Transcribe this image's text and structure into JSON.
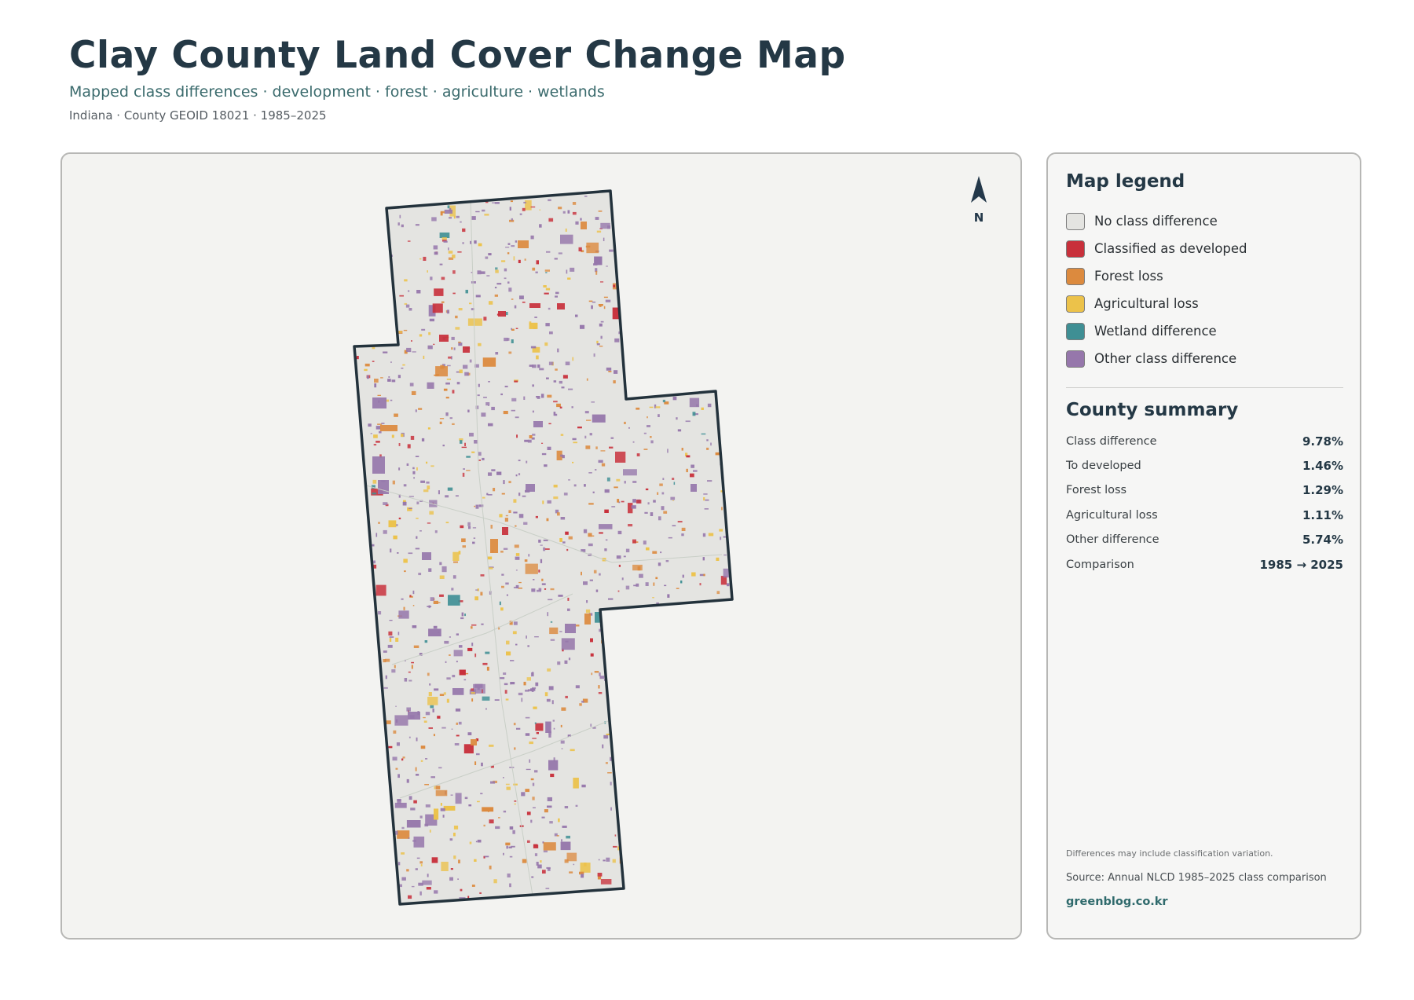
{
  "header": {
    "title": "Clay County Land Cover Change Map",
    "subtitle": "Mapped class differences · development · forest · agriculture · wetlands",
    "meta": "Indiana · County GEOID 18021 · 1985–2025"
  },
  "map": {
    "north_label": "N",
    "north_icon": "north-arrow-icon",
    "colors": {
      "background": "#f3f3f1",
      "county_fill": "#e4e4e1",
      "county_outline": "#23323c",
      "developed": "#c8303b",
      "forest_loss": "#dc8a3e",
      "agricultural_loss": "#ecc24a",
      "wetland": "#3f8f94",
      "other": "#9677ab"
    }
  },
  "legend": {
    "title": "Map legend",
    "items": [
      {
        "label": "No class difference",
        "color": "#e4e4e1"
      },
      {
        "label": "Classified as developed",
        "color": "#c8303b"
      },
      {
        "label": "Forest loss",
        "color": "#dc8a3e"
      },
      {
        "label": "Agricultural loss",
        "color": "#ecc24a"
      },
      {
        "label": "Wetland difference",
        "color": "#3f8f94"
      },
      {
        "label": "Other class difference",
        "color": "#9677ab"
      }
    ]
  },
  "summary": {
    "title": "County summary",
    "rows": [
      {
        "label": "Class difference",
        "value": "9.78%"
      },
      {
        "label": "To developed",
        "value": "1.46%"
      },
      {
        "label": "Forest loss",
        "value": "1.29%"
      },
      {
        "label": "Agricultural loss",
        "value": "1.11%"
      },
      {
        "label": "Other difference",
        "value": "5.74%"
      },
      {
        "label": "Comparison",
        "value": "1985 → 2025"
      }
    ]
  },
  "footer": {
    "note": "Differences may include classification variation.",
    "source": "Source: Annual NLCD 1985–2025 class comparison",
    "brand": "greenblog.co.kr"
  }
}
